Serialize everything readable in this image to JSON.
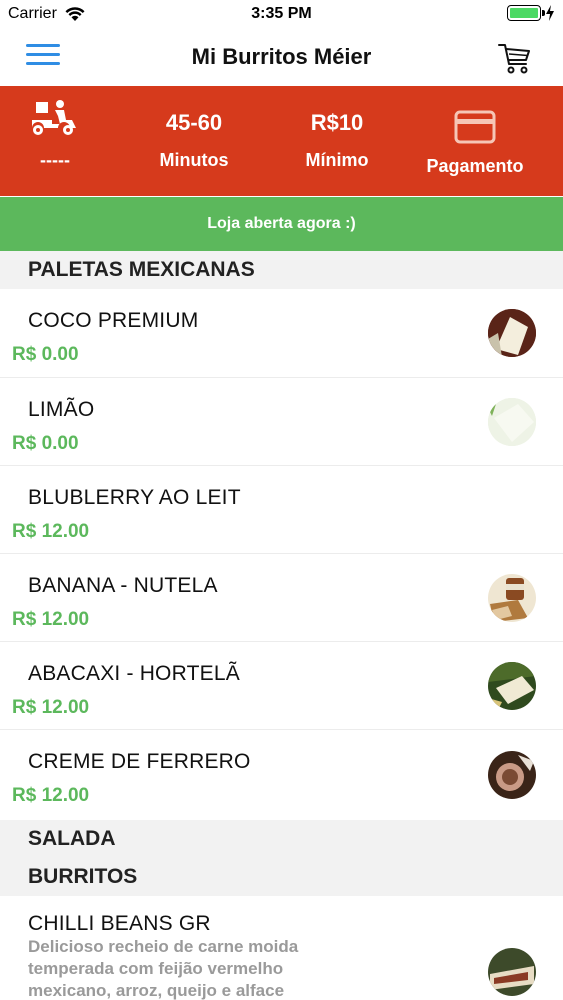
{
  "status_bar": {
    "carrier": "Carrier",
    "time": "3:35 PM"
  },
  "nav": {
    "title": "Mi Burritos Méier"
  },
  "info": {
    "delivery_fee": "-----",
    "time_range": "45-60",
    "time_unit": "Minutos",
    "minimum_value": "R$10",
    "minimum_label": "Mínimo",
    "payment_label": "Pagamento"
  },
  "banner": {
    "text": "Loja aberta agora :)"
  },
  "sections": {
    "paletas": "PALETAS MEXICANAS",
    "salada": "SALADA",
    "burritos": "BURRITOS"
  },
  "paletas_items": [
    {
      "name": "COCO PREMIUM",
      "price": "R$ 0.00"
    },
    {
      "name": "LIMÃO",
      "price": "R$ 0.00"
    },
    {
      "name": "BLUBLERRY AO LEIT",
      "price": "R$ 12.00"
    },
    {
      "name": "BANANA - NUTELA",
      "price": "R$ 12.00"
    },
    {
      "name": "ABACAXI - HORTELÃ",
      "price": "R$ 12.00"
    },
    {
      "name": "CREME DE FERRERO",
      "price": "R$ 12.00"
    }
  ],
  "burritos_items": [
    {
      "name": "CHILLI BEANS GR",
      "description": "Delicioso recheio de carne moida temperada com feijão vermelho mexicano, arroz, queijo e alface"
    }
  ],
  "colors": {
    "accent_red": "#d63a1c",
    "open_green": "#5cb85c",
    "menu_blue": "#2f8de4"
  }
}
